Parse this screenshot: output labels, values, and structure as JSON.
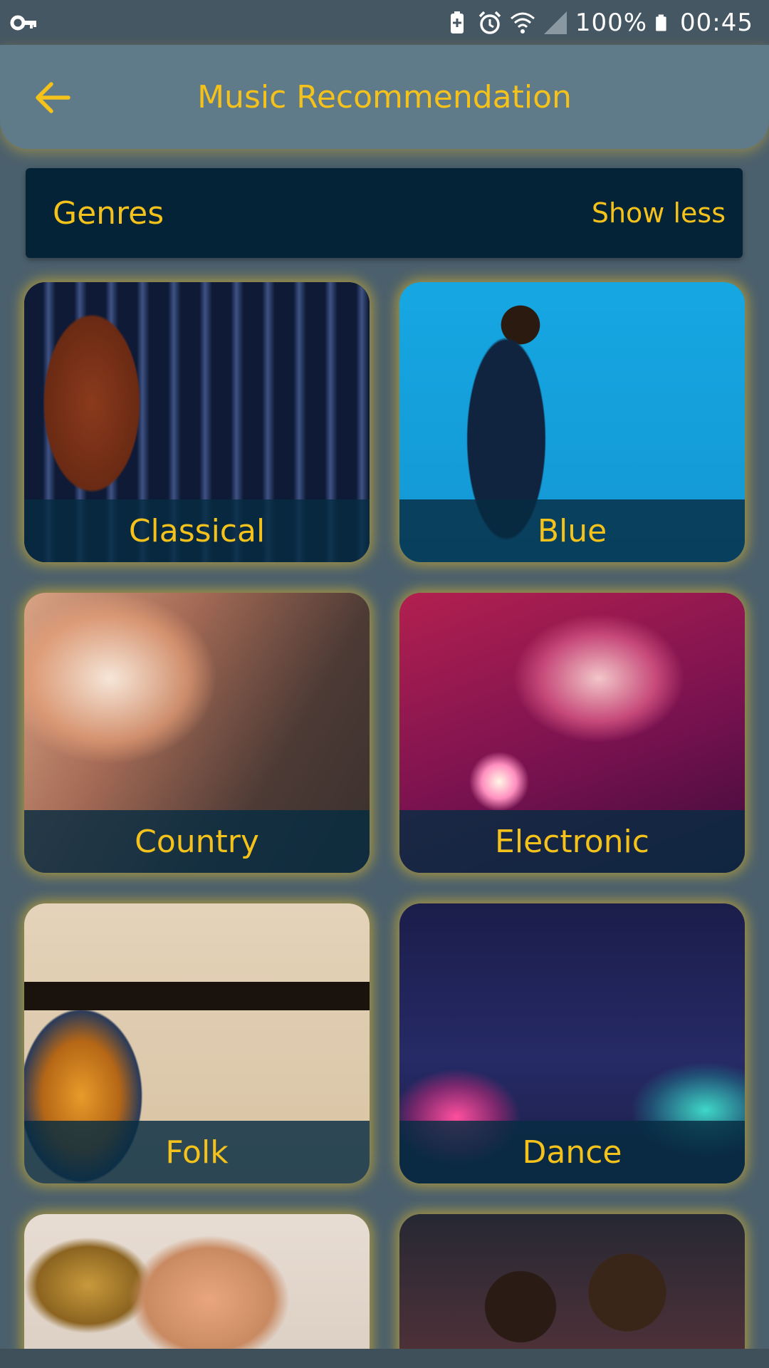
{
  "status_bar": {
    "battery_text": "100%",
    "time": "00:45",
    "icons": [
      "key-icon",
      "battery-saver-icon",
      "alarm-icon",
      "wifi-icon",
      "signal-icon",
      "battery-icon"
    ]
  },
  "app_bar": {
    "title": "Music Recommendation",
    "back_icon": "arrow-left-icon"
  },
  "genres_header": {
    "label": "Genres",
    "toggle_label": "Show less"
  },
  "genres": [
    {
      "name": "Classical",
      "image": "violin-photo"
    },
    {
      "name": "Blue",
      "image": "saxophone-player-photo"
    },
    {
      "name": "Country",
      "image": "acoustic-guitar-photo"
    },
    {
      "name": "Electronic",
      "image": "dj-woman-photo"
    },
    {
      "name": "Folk",
      "image": "mandolin-photo"
    },
    {
      "name": "Dance",
      "image": "dj-mixer-photo"
    },
    {
      "name": "",
      "image": "trumpet-photo"
    },
    {
      "name": "",
      "image": "hiphop-group-photo"
    }
  ],
  "colors": {
    "accent": "#f5c21b",
    "app_bar": "#5f7a88",
    "background": "#4b606d",
    "header_bar": "#052336",
    "caption_bg": "#062c42"
  }
}
